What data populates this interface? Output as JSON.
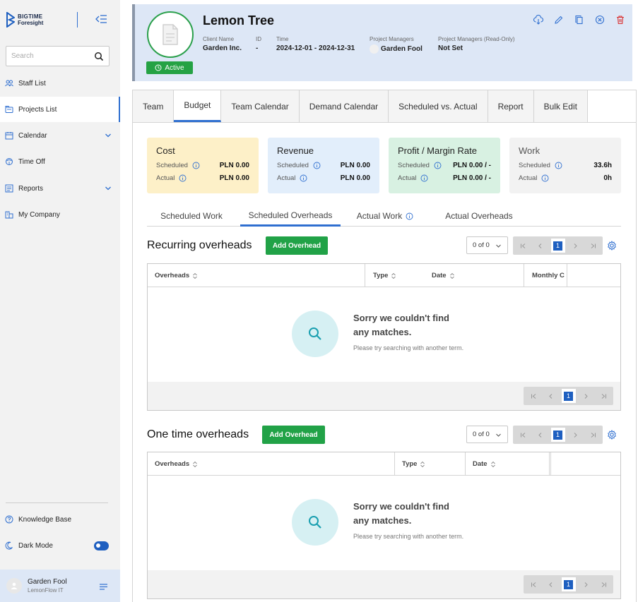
{
  "sidebar": {
    "logo_line1": "BIGTIME",
    "logo_line2": "Foresight",
    "search_placeholder": "Search",
    "items": [
      {
        "label": "Staff List",
        "icon": "users-icon"
      },
      {
        "label": "Projects List",
        "icon": "folder-icon",
        "active": true
      },
      {
        "label": "Calendar",
        "icon": "calendar-icon",
        "expandable": true
      },
      {
        "label": "Time Off",
        "icon": "time-off-icon"
      },
      {
        "label": "Reports",
        "icon": "reports-icon",
        "expandable": true
      },
      {
        "label": "My Company",
        "icon": "building-icon"
      }
    ],
    "knowledge_base": "Knowledge Base",
    "dark_mode": "Dark Mode",
    "dark_mode_on": true,
    "user_name": "Garden Fool",
    "user_org": "LemonFlow IT"
  },
  "project": {
    "title": "Lemon Tree",
    "status": "Active",
    "client_label": "Client Name",
    "client_value": "Garden Inc.",
    "id_label": "ID",
    "id_value": "-",
    "time_label": "Time",
    "time_value": "2024-12-01 - 2024-12-31",
    "pm_label": "Project Managers",
    "pm_value": "Garden Fool",
    "pm_ro_label": "Project Managers (Read-Only)",
    "pm_ro_value": "Not Set"
  },
  "tabs": [
    "Team",
    "Budget",
    "Team Calendar",
    "Demand Calendar",
    "Scheduled vs. Actual",
    "Report",
    "Bulk Edit"
  ],
  "cards": {
    "cost": {
      "title": "Cost",
      "sched_label": "Scheduled",
      "sched_value": "PLN 0.00",
      "act_label": "Actual",
      "act_value": "PLN 0.00",
      "color": "#fdf0c8"
    },
    "revenue": {
      "title": "Revenue",
      "sched_label": "Scheduled",
      "sched_value": "PLN 0.00",
      "act_label": "Actual",
      "act_value": "PLN 0.00",
      "color": "#e2eefb"
    },
    "profit": {
      "title": "Profit / Margin Rate",
      "sched_label": "Scheduled",
      "sched_value": "PLN 0.00 / -",
      "act_label": "Actual",
      "act_value": "PLN 0.00 / -",
      "color": "#d8f1e2"
    },
    "work": {
      "title": "Work",
      "sched_label": "Scheduled",
      "sched_value": "33.6h",
      "act_label": "Actual",
      "act_value": "0h",
      "color": "#f2f2f2"
    }
  },
  "subtabs": [
    "Scheduled Work",
    "Scheduled Overheads",
    "Actual Work",
    "Actual Overheads"
  ],
  "recurring": {
    "title": "Recurring overheads",
    "add_label": "Add Overhead",
    "count": "0 of 0",
    "page": "1",
    "columns": [
      "Overheads",
      "Type",
      "Date",
      "Monthly C"
    ],
    "empty_title": "Sorry we couldn't find any matches.",
    "empty_sub": "Please try searching with another term.",
    "footer_page": "1"
  },
  "onetime": {
    "title": "One time overheads",
    "add_label": "Add Overhead",
    "count": "0 of 0",
    "page": "1",
    "columns": [
      "Overheads",
      "Type",
      "Date"
    ],
    "empty_title": "Sorry we couldn't find any matches.",
    "empty_sub": "Please try searching with another term.",
    "footer_page": "1"
  },
  "colors": {
    "accent": "#2f6fd0",
    "green": "#21a247",
    "header_bg": "#dde7f6"
  }
}
